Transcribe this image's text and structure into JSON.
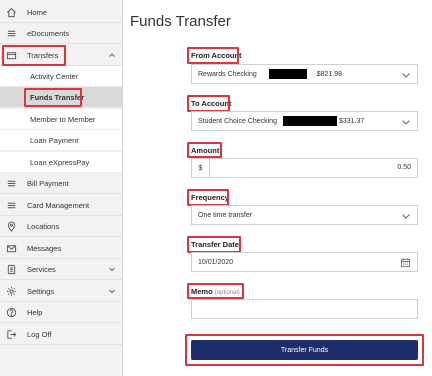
{
  "sidebar": {
    "items": [
      {
        "label": "Home",
        "icon": "home-icon"
      },
      {
        "label": "eDocuments",
        "icon": "menu-icon"
      },
      {
        "label": "Transfers",
        "icon": "card-icon"
      },
      {
        "label": "Bill Payment",
        "icon": "menu-icon"
      },
      {
        "label": "Card Management",
        "icon": "menu-icon"
      },
      {
        "label": "Locations",
        "icon": "location-pin-icon"
      },
      {
        "label": "Messages",
        "icon": "envelope-icon"
      },
      {
        "label": "Services",
        "icon": "services-icon"
      },
      {
        "label": "Settings",
        "icon": "gear-icon"
      },
      {
        "label": "Help",
        "icon": "help-icon"
      },
      {
        "label": "Log Off",
        "icon": "logout-icon"
      }
    ],
    "transfers_sub": [
      {
        "label": "Activity Center"
      },
      {
        "label": "Funds Transfer",
        "active": true
      },
      {
        "label": "Member to Member"
      },
      {
        "label": "Loan Payment"
      },
      {
        "label": "Loan eXpressPay"
      }
    ]
  },
  "main": {
    "title": "Funds Transfer",
    "from_account": {
      "label": "From Account",
      "value": "Rewards Checking",
      "amount": "$821.98"
    },
    "to_account": {
      "label": "To Account",
      "value": "Student Choice Checking",
      "amount": "$331.37"
    },
    "amount": {
      "label": "Amount",
      "prefix": "$",
      "value": "0.50"
    },
    "frequency": {
      "label": "Frequency",
      "value": "One time transfer"
    },
    "transfer_date": {
      "label": "Transfer Date",
      "value": "10/01/2020"
    },
    "memo": {
      "label": "Memo",
      "optional": "(optional)",
      "value": ""
    },
    "submit_label": "Transfer Funds"
  },
  "colors": {
    "highlight": "#e0343b",
    "primary_button": "#1e2d6b",
    "sidebar_bg": "#f2f2f2"
  }
}
